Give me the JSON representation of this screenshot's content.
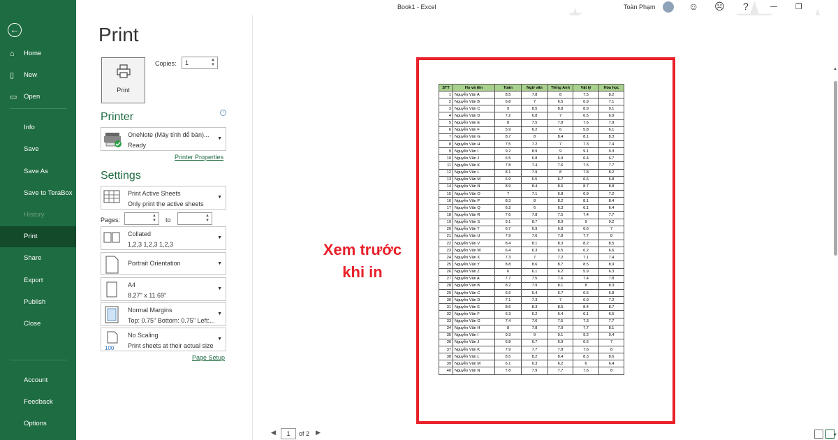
{
  "titlebar": {
    "title": "Book1  -  Excel",
    "user": "Toàn Phạm"
  },
  "nav": {
    "items": [
      {
        "label": "Home",
        "icon": "home-icon"
      },
      {
        "label": "New",
        "icon": "new-document-icon"
      },
      {
        "label": "Open",
        "icon": "open-folder-icon"
      },
      {
        "label": "Info"
      },
      {
        "label": "Save"
      },
      {
        "label": "Save As"
      },
      {
        "label": "Save to TeraBox"
      },
      {
        "label": "History"
      },
      {
        "label": "Print"
      },
      {
        "label": "Share"
      },
      {
        "label": "Export"
      },
      {
        "label": "Publish"
      },
      {
        "label": "Close"
      },
      {
        "label": "Account"
      },
      {
        "label": "Feedback"
      },
      {
        "label": "Options"
      }
    ],
    "active": "Print",
    "disabled": "History"
  },
  "print": {
    "page_title": "Print",
    "print_button": "Print",
    "copies_label": "Copies:",
    "copies_value": "1",
    "printer_heading": "Printer",
    "printer_name": "OneNote (Máy tính để bàn)...",
    "printer_status": "Ready",
    "printer_properties": "Printer Properties",
    "settings_heading": "Settings",
    "settings": [
      {
        "line1": "Print Active Sheets",
        "line2": "Only print the active sheets"
      },
      {
        "line1": "Collated",
        "line2": "1,2,3    1,2,3    1,2,3"
      },
      {
        "line1": "Portrait Orientation",
        "line2": ""
      },
      {
        "line1": "A4",
        "line2": "8.27\" x 11.69\""
      },
      {
        "line1": "Normal Margins",
        "line2": "Top: 0.75\" Bottom: 0.75\" Left:..."
      },
      {
        "line1": "No Scaling",
        "line2": "Print sheets at their actual size"
      }
    ],
    "pages_label": "Pages:",
    "to_label": "to",
    "page_setup": "Page Setup"
  },
  "preview": {
    "annotation_line1": "Xem trước",
    "annotation_line2": "khi in",
    "current_page": "1",
    "of_pages": "of 2"
  },
  "sheet": {
    "headers": [
      "STT",
      "Họ và tên",
      "Toán",
      "Ngữ văn",
      "Tiếng Anh",
      "Vật lý",
      "Hóa học"
    ],
    "rows": [
      [
        "1",
        "Nguyễn Văn A",
        "8.5",
        "7.8",
        "8",
        "7.5",
        "8.2"
      ],
      [
        "2",
        "Nguyễn Văn B",
        "6.8",
        "7",
        "6.5",
        "6.9",
        "7.1"
      ],
      [
        "3",
        "Nguyễn Văn C",
        "9",
        "8.5",
        "8.8",
        "8.9",
        "9.1"
      ],
      [
        "4",
        "Nguyễn Văn D",
        "7.2",
        "6.8",
        "7",
        "6.5",
        "6.9"
      ],
      [
        "5",
        "Nguyễn Văn E",
        "8",
        "7.5",
        "7.8",
        "7.6",
        "7.9"
      ],
      [
        "6",
        "Nguyễn Văn F",
        "5.9",
        "6.2",
        "6",
        "5.8",
        "6.1"
      ],
      [
        "7",
        "Nguyễn Văn G",
        "8.7",
        "8",
        "8.4",
        "8.1",
        "8.3"
      ],
      [
        "8",
        "Nguyễn Văn H",
        "7.5",
        "7.2",
        "7",
        "7.3",
        "7.4"
      ],
      [
        "9",
        "Nguyễn Văn I",
        "9.2",
        "8.9",
        "9",
        "9.1",
        "9.3"
      ],
      [
        "10",
        "Nguyễn Văn J",
        "6.5",
        "6.8",
        "6.9",
        "6.4",
        "6.7"
      ],
      [
        "11",
        "Nguyễn Văn K",
        "7.8",
        "7.4",
        "7.6",
        "7.5",
        "7.7"
      ],
      [
        "12",
        "Nguyễn Văn L",
        "8.1",
        "7.9",
        "8",
        "7.8",
        "8.2"
      ],
      [
        "13",
        "Nguyễn Văn M",
        "6.9",
        "6.5",
        "6.7",
        "6.6",
        "6.8"
      ],
      [
        "14",
        "Nguyễn Văn N",
        "8.9",
        "8.4",
        "8.6",
        "8.7",
        "8.8"
      ],
      [
        "15",
        "Nguyễn Văn O",
        "7",
        "7.1",
        "6.8",
        "6.9",
        "7.2"
      ],
      [
        "16",
        "Nguyễn Văn P",
        "8.3",
        "8",
        "8.2",
        "8.1",
        "8.4"
      ],
      [
        "17",
        "Nguyễn Văn Q",
        "6.2",
        "6",
        "6.3",
        "6.1",
        "6.4"
      ],
      [
        "18",
        "Nguyễn Văn R",
        "7.6",
        "7.8",
        "7.5",
        "7.4",
        "7.7"
      ],
      [
        "19",
        "Nguyễn Văn S",
        "9.1",
        "8.7",
        "8.9",
        "9",
        "9.2"
      ],
      [
        "20",
        "Nguyễn Văn T",
        "6.7",
        "6.9",
        "6.8",
        "6.6",
        "7"
      ],
      [
        "21",
        "Nguyễn Văn U",
        "7.9",
        "7.6",
        "7.8",
        "7.7",
        "8"
      ],
      [
        "22",
        "Nguyễn Văn V",
        "8.4",
        "8.1",
        "8.3",
        "8.2",
        "8.5"
      ],
      [
        "23",
        "Nguyễn Văn W",
        "6.4",
        "6.3",
        "6.5",
        "6.2",
        "6.6"
      ],
      [
        "24",
        "Nguyễn Văn X",
        "7.3",
        "7",
        "7.2",
        "7.1",
        "7.4"
      ],
      [
        "25",
        "Nguyễn Văn Y",
        "8.8",
        "8.6",
        "8.7",
        "8.5",
        "8.9"
      ],
      [
        "26",
        "Nguyễn Văn Z",
        "6",
        "6.1",
        "6.2",
        "5.9",
        "6.3"
      ],
      [
        "27",
        "Nguyễn Văn A",
        "7.7",
        "7.5",
        "7.6",
        "7.4",
        "7.8"
      ],
      [
        "28",
        "Nguyễn Văn B",
        "8.2",
        "7.9",
        "8.1",
        "8",
        "8.3"
      ],
      [
        "29",
        "Nguyễn Văn C",
        "6.6",
        "6.4",
        "6.7",
        "6.5",
        "6.8"
      ],
      [
        "30",
        "Nguyễn Văn D",
        "7.1",
        "7.3",
        "7",
        "6.9",
        "7.2"
      ],
      [
        "31",
        "Nguyễn Văn E",
        "8.6",
        "8.3",
        "8.5",
        "8.4",
        "8.7"
      ],
      [
        "32",
        "Nguyễn Văn F",
        "6.3",
        "6.2",
        "6.4",
        "6.1",
        "6.5"
      ],
      [
        "33",
        "Nguyễn Văn G",
        "7.4",
        "7.6",
        "7.5",
        "7.3",
        "7.7"
      ],
      [
        "34",
        "Nguyễn Văn H",
        "8",
        "7.8",
        "7.9",
        "7.7",
        "8.1"
      ],
      [
        "35",
        "Nguyễn Văn I",
        "9.3",
        "9",
        "9.1",
        "9.2",
        "9.4"
      ],
      [
        "36",
        "Nguyễn Văn J",
        "6.8",
        "6.7",
        "6.9",
        "6.6",
        "7"
      ],
      [
        "37",
        "Nguyễn Văn K",
        "7.9",
        "7.7",
        "7.8",
        "7.6",
        "8"
      ],
      [
        "38",
        "Nguyễn Văn L",
        "8.5",
        "8.2",
        "8.4",
        "8.3",
        "8.6"
      ],
      [
        "39",
        "Nguyễn Văn M",
        "6.1",
        "6.3",
        "6.2",
        "6",
        "6.4"
      ],
      [
        "40",
        "Nguyễn Văn N",
        "7.8",
        "7.9",
        "7.7",
        "7.6",
        "8"
      ]
    ]
  },
  "colors": {
    "nav_green": "#1e6c41",
    "nav_active": "#124a2a",
    "annotation_red": "#e8212a",
    "header_fill": "#a9d18e"
  }
}
